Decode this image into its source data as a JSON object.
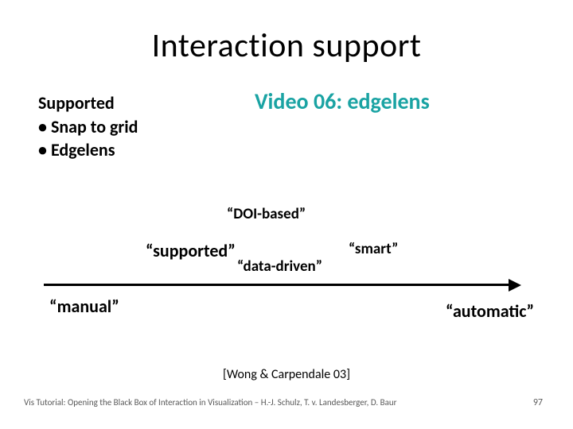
{
  "title": "Interaction support",
  "supported": {
    "heading": "Supported",
    "items": [
      "Snap to grid",
      "Edgelens"
    ]
  },
  "video_label": "Video 06: edgelens",
  "scale": {
    "doi": "“DOI-based”",
    "supported": "“supported”",
    "data_driven": "“data-driven”",
    "smart": "“smart”",
    "manual": "“manual”",
    "automatic": "“automatic”"
  },
  "citation": "[Wong & Carpendale 03]",
  "footer": "Vis Tutorial: Opening the Black Box of Interaction in Visualization – H.-J. Schulz, T. v. Landesberger, D. Baur",
  "page_number": "97"
}
